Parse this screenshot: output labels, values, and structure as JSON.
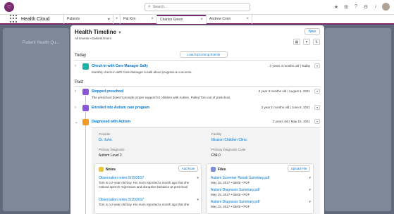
{
  "global_header": {
    "search_placeholder": "Search..."
  },
  "navbar": {
    "app_name": "Health Cloud",
    "tabs": [
      {
        "label": "Patients"
      },
      {
        "label": "Pat Kim"
      },
      {
        "label": "Charles Green"
      },
      {
        "label": "Andrew Conn"
      }
    ]
  },
  "background": {
    "title": "Patient Health Qu..."
  },
  "modal": {
    "title": "Health Timeline",
    "subtitle": "All Events • Earliest Event",
    "new_label": "New",
    "today_label": "Today",
    "load_label": "Load Upcoming Events",
    "past_label": "Past",
    "items": [
      {
        "title": "Check-in with Care Manager Sally",
        "date": "2 years 4 months old | Today",
        "desc": "Monthly check-in with Care Manager to talk about progress & concerns.",
        "color": "#19b3a7"
      },
      {
        "title": "Stopped preschool",
        "date": "2 year 3 months old | August 1, 2021",
        "desc": "The preschool doesn't provide proper support for children with Autism. Pulled Tom out of preschool.",
        "color": "#8a56d8"
      },
      {
        "title": "Enrolled into Autism care program",
        "date": "2 year 1 months old | June 6, 2021",
        "desc": "",
        "color": "#8a56d8"
      },
      {
        "title": "Diagnosed with Autism",
        "date": "2 years old | May 15, 2021",
        "desc": "",
        "color": "#f49b20"
      }
    ],
    "details": {
      "provider_label": "Provider",
      "provider_value": "Dr. John",
      "facility_label": "Facility",
      "facility_value": "Mission Children Clinic",
      "primary_dx_label": "Primary Diagnosis",
      "primary_dx_value": "Autism Level 2",
      "dx_code_label": "Primary Diagnosis Code",
      "dx_code_value": "F84.0",
      "notes": {
        "title": "Notes",
        "button": "Add Note",
        "entries": [
          {
            "title": "Observation notes 5/15/2017",
            "text": "Tom is a 2-year-old boy. His mom reported a month ago that she noticed speech regression and disruptive behavior at preschool."
          },
          {
            "title": "Observation notes 5/15/2017",
            "text": "Tom is a 2-year-old boy. His mom reported a month ago that she"
          }
        ]
      },
      "files": {
        "title": "Files",
        "button": "Upload File",
        "entries": [
          {
            "title": "Autism Screener Result Summary.pdf",
            "meta": "May 15, 2017 • 55KB • PDF"
          },
          {
            "title": "Autism Diagnosis Summary.pdf",
            "meta": "May 15, 2017 • 55KB • PDF"
          },
          {
            "title": "Autism Diagnosis Summary.pdf",
            "meta": "May 15, 2017 • 55KB • PDF"
          }
        ]
      }
    }
  }
}
